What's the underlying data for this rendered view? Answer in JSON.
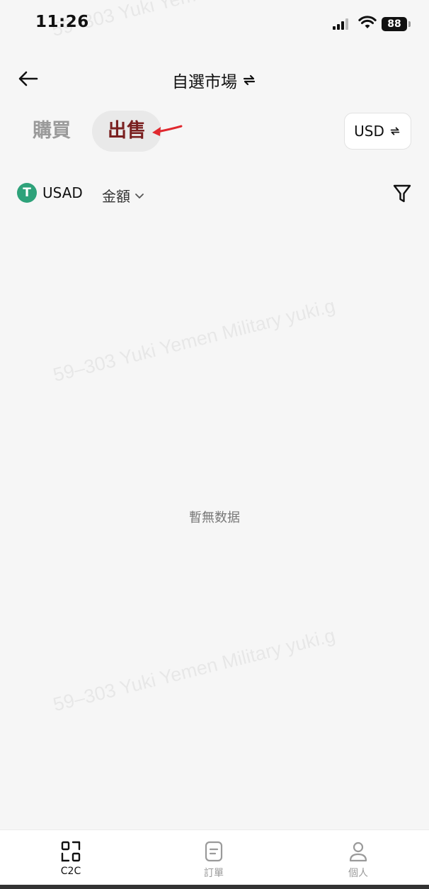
{
  "status_bar": {
    "time": "11:26",
    "battery": "88"
  },
  "header": {
    "title": "自選市場"
  },
  "trade_tabs": {
    "buy": "購買",
    "sell": "出售",
    "active": "sell"
  },
  "currency": {
    "label": "USD"
  },
  "filters": {
    "coin": "USAD",
    "coin_logo": "T",
    "amount": "金額"
  },
  "empty_state": {
    "text": "暫無数据"
  },
  "watermark": {
    "text": "59–303 Yuki Yemen Military yuki.g"
  },
  "bottom_nav": {
    "items": [
      {
        "label": "C2C",
        "icon": "c2c-icon",
        "active": true
      },
      {
        "label": "訂單",
        "icon": "orders-icon",
        "active": false
      },
      {
        "label": "個人",
        "icon": "profile-icon",
        "active": false
      }
    ]
  },
  "colors": {
    "sell_active": "#7a2020",
    "arrow": "#e0282e",
    "coin_logo": "#2ea27a"
  }
}
